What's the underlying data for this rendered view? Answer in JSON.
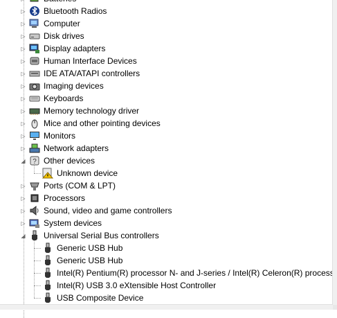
{
  "device_tree": {
    "categories": [
      {
        "label": "Batteries",
        "icon": "battery-icon",
        "expanded": false
      },
      {
        "label": "Bluetooth Radios",
        "icon": "bluetooth-icon",
        "expanded": false
      },
      {
        "label": "Computer",
        "icon": "computer-icon",
        "expanded": false
      },
      {
        "label": "Disk drives",
        "icon": "disk-drive-icon",
        "expanded": false
      },
      {
        "label": "Display adapters",
        "icon": "display-adapter-icon",
        "expanded": false
      },
      {
        "label": "Human Interface Devices",
        "icon": "hid-icon",
        "expanded": false
      },
      {
        "label": "IDE ATA/ATAPI controllers",
        "icon": "ide-controller-icon",
        "expanded": false
      },
      {
        "label": "Imaging devices",
        "icon": "camera-icon",
        "expanded": false
      },
      {
        "label": "Keyboards",
        "icon": "keyboard-icon",
        "expanded": false
      },
      {
        "label": "Memory technology driver",
        "icon": "memory-icon",
        "expanded": false
      },
      {
        "label": "Mice and other pointing devices",
        "icon": "mouse-icon",
        "expanded": false
      },
      {
        "label": "Monitors",
        "icon": "monitor-icon",
        "expanded": false
      },
      {
        "label": "Network adapters",
        "icon": "network-adapter-icon",
        "expanded": false
      },
      {
        "label": "Other devices",
        "icon": "other-devices-icon",
        "expanded": true,
        "children": [
          {
            "label": "Unknown device",
            "icon": "unknown-device-warning-icon"
          }
        ]
      },
      {
        "label": "Ports (COM & LPT)",
        "icon": "port-icon",
        "expanded": false
      },
      {
        "label": "Processors",
        "icon": "processor-icon",
        "expanded": false
      },
      {
        "label": "Sound, video and game controllers",
        "icon": "speaker-icon",
        "expanded": false
      },
      {
        "label": "System devices",
        "icon": "system-devices-icon",
        "expanded": false
      },
      {
        "label": "Universal Serial Bus controllers",
        "icon": "usb-icon",
        "expanded": true,
        "children": [
          {
            "label": "Generic USB Hub",
            "icon": "usb-icon"
          },
          {
            "label": "Generic USB Hub",
            "icon": "usb-icon"
          },
          {
            "label": "Intel(R) Pentium(R) processor N- and J-series / Intel(R) Celeron(R) processor",
            "icon": "usb-icon"
          },
          {
            "label": "Intel(R) USB 3.0 eXtensible Host Controller",
            "icon": "usb-icon"
          },
          {
            "label": "USB Composite Device",
            "icon": "usb-icon"
          }
        ]
      }
    ],
    "collapsed_glyph": "▷",
    "expanded_glyph": "◢"
  }
}
